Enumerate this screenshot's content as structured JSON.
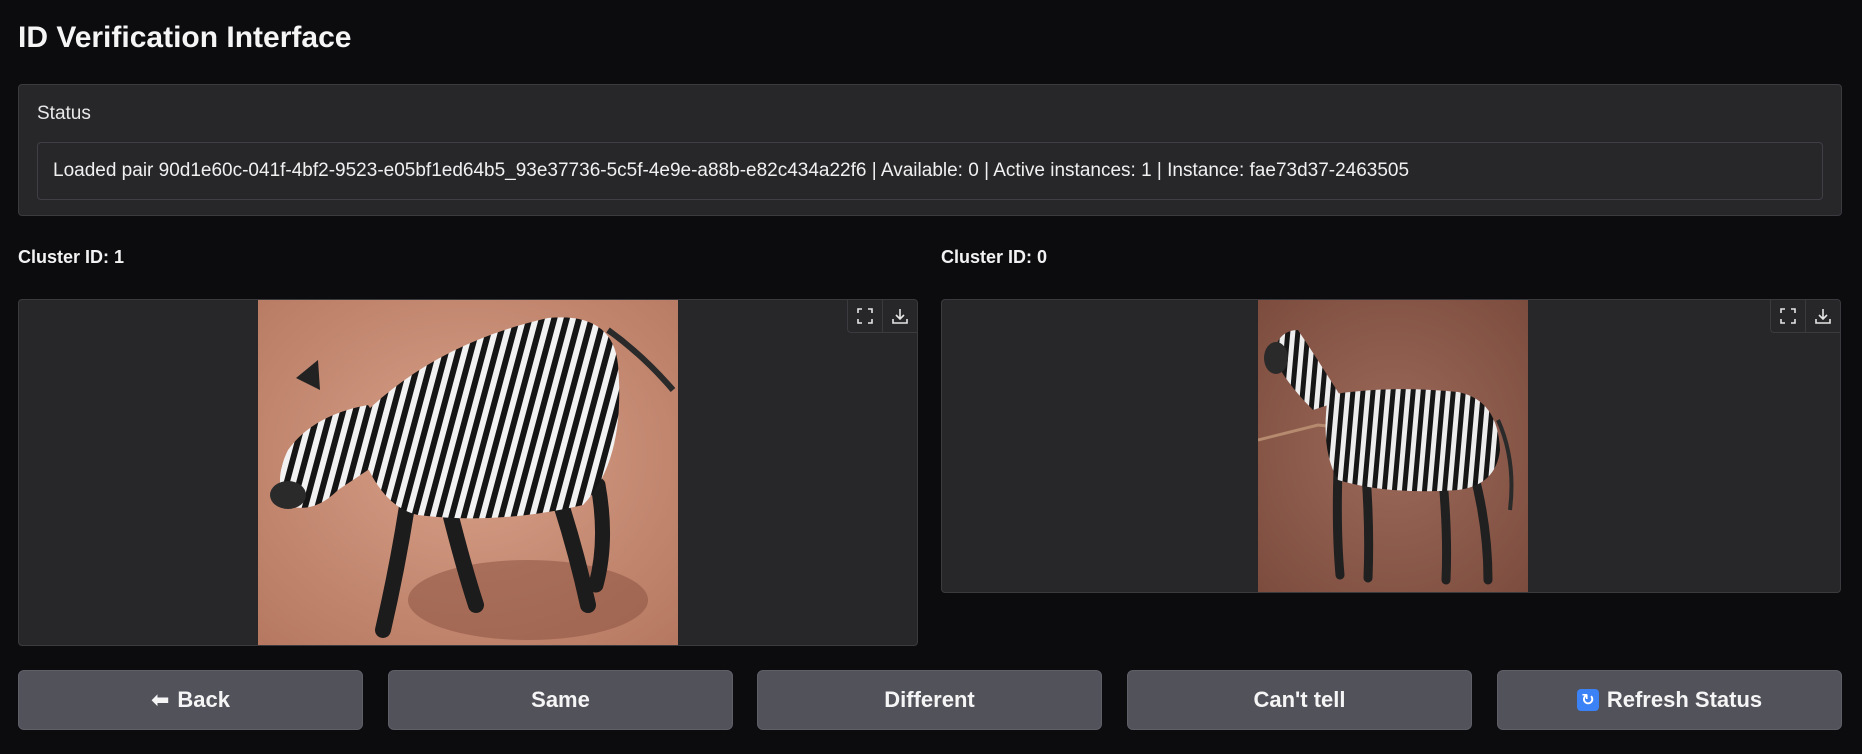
{
  "app": {
    "title": "ID Verification Interface"
  },
  "status": {
    "label": "Status",
    "text": "Loaded pair 90d1e60c-041f-4bf2-9523-e05bf1ed64b5_93e37736-5c5f-4e9e-a88b-e82c434a22f6 | Available: 0 | Active instances: 1 | Instance: fae73d37-2463505"
  },
  "left": {
    "cluster_label": "Cluster ID: 1",
    "image_alt": "zebra walking on red dirt",
    "tools": [
      "fullscreen-icon",
      "download-icon"
    ]
  },
  "right": {
    "cluster_label": "Cluster ID: 0",
    "image_alt": "zebra standing on red dirt",
    "tools": [
      "fullscreen-icon",
      "download-icon"
    ]
  },
  "buttons": {
    "back": {
      "label": "Back",
      "icon": "arrow-left-icon",
      "glyph": "⬅"
    },
    "same": {
      "label": "Same"
    },
    "different": {
      "label": "Different"
    },
    "cant_tell": {
      "label": "Can't tell"
    },
    "refresh": {
      "label": "Refresh Status",
      "icon": "refresh-icon",
      "glyph": "↻"
    }
  },
  "colors": {
    "background": "#0c0c0f",
    "panel": "#27272a",
    "button": "#52525b",
    "refresh_accent": "#3b82f6"
  }
}
